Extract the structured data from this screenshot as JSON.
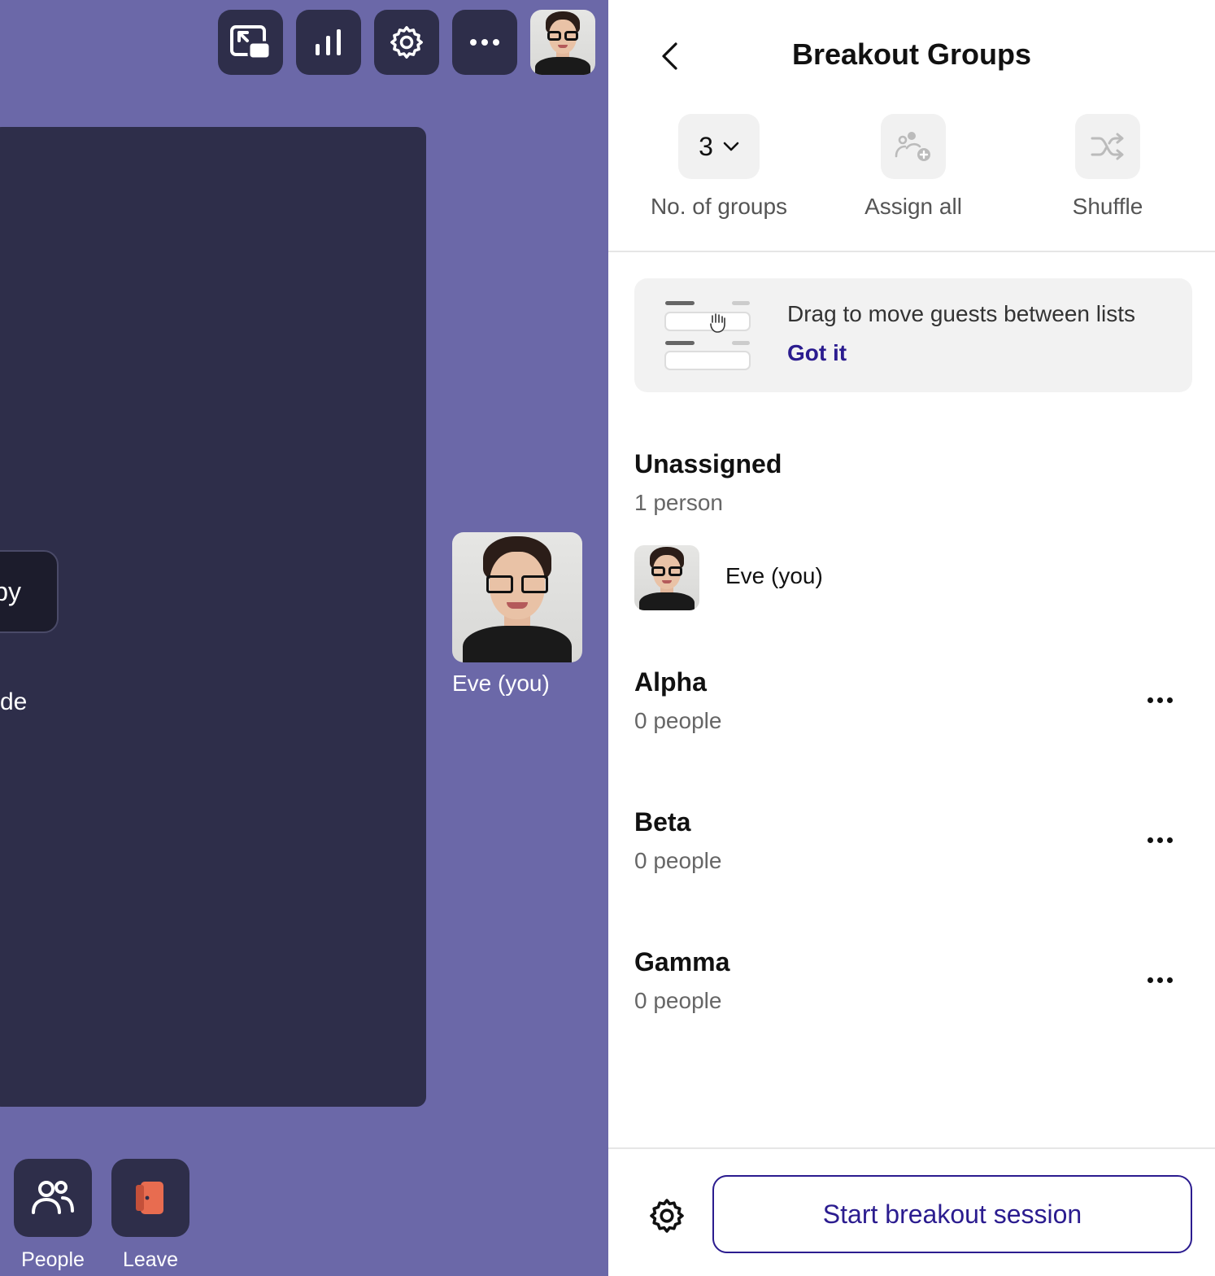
{
  "call": {
    "top_buttons": [
      {
        "name": "pip-icon"
      },
      {
        "name": "stats-icon"
      },
      {
        "name": "gear-icon"
      },
      {
        "name": "more-icon"
      }
    ],
    "stage_pill_text": "py",
    "stage_text": "de",
    "self_tile_name": "Eve (you)",
    "bottom": {
      "people_label": "People",
      "leave_label": "Leave"
    }
  },
  "panel": {
    "title": "Breakout Groups",
    "controls": {
      "groups_value": "3",
      "groups_label": "No. of groups",
      "assign_label": "Assign all",
      "shuffle_label": "Shuffle"
    },
    "tip": {
      "text": "Drag to move guests between lists",
      "link": "Got it"
    },
    "unassigned": {
      "title": "Unassigned",
      "count": "1 person",
      "people": [
        {
          "name": "Eve (you)"
        }
      ]
    },
    "groups": [
      {
        "title": "Alpha",
        "count": "0 people"
      },
      {
        "title": "Beta",
        "count": "0 people"
      },
      {
        "title": "Gamma",
        "count": "0 people"
      }
    ],
    "start_label": "Start breakout session"
  },
  "colors": {
    "call_bg": "#6b68a8",
    "tile_bg": "#2e2e4a",
    "accent": "#2b1c8f",
    "leave": "#e86c50"
  }
}
